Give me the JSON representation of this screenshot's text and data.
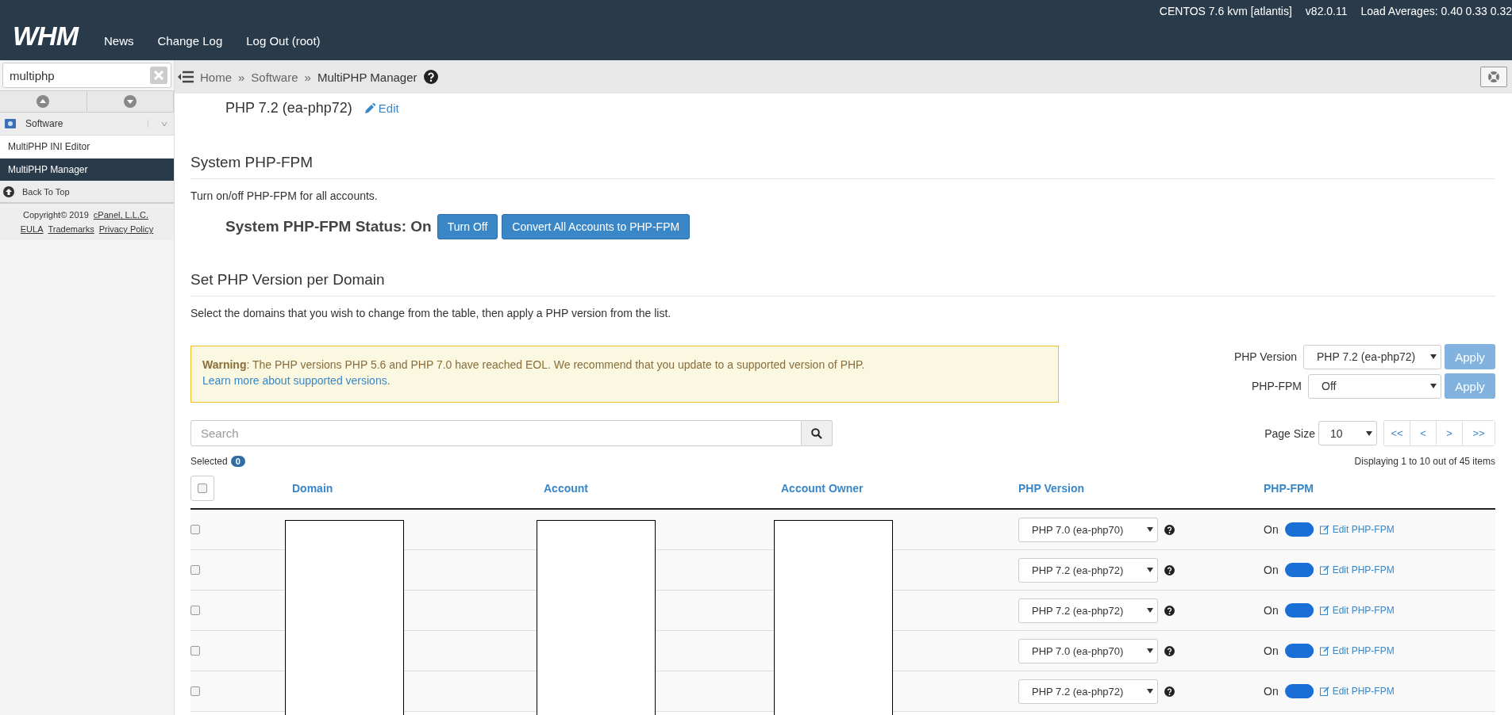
{
  "header": {
    "logo": "WHM",
    "nav": [
      "News",
      "Change Log",
      "Log Out (root)"
    ],
    "server_info": [
      "CENTOS 7.6 kvm [atlantis]",
      "v82.0.11",
      "Load Averages: 0.40 0.33 0.32"
    ]
  },
  "sidebar": {
    "search_value": "multiphp",
    "category": "Software",
    "items": [
      {
        "label": "MultiPHP INI Editor",
        "selected": false
      },
      {
        "label": "MultiPHP Manager",
        "selected": true
      }
    ],
    "back_to_top": "Back To Top",
    "copyright": "Copyright© 2019",
    "company": "cPanel, L.L.C.",
    "links": [
      "EULA",
      "Trademarks",
      "Privacy Policy"
    ]
  },
  "breadcrumb": [
    {
      "label": "Home",
      "separator": "»"
    },
    {
      "label": "Software",
      "separator": "»"
    },
    {
      "label": "MultiPHP Manager"
    }
  ],
  "system_default": {
    "version": "PHP 7.2 (ea-php72)",
    "edit": "Edit"
  },
  "fpm_section": {
    "title": "System PHP-FPM",
    "description": "Turn on/off PHP-FPM for all accounts.",
    "status": "System PHP-FPM Status: On",
    "buttons": [
      "Turn Off",
      "Convert All Accounts to PHP-FPM"
    ]
  },
  "domain_section": {
    "title": "Set PHP Version per Domain",
    "description": "Select the domains that you wish to change from the table, then apply a PHP version from the list.",
    "warning": {
      "text": "**Warning**: The PHP versions PHP 5.6 and PHP 7.0 have reached EOL. We recommend that you update to a supported version of PHP.",
      "link": "Learn more about supported versions",
      "after": "."
    },
    "controls": [
      {
        "label": "PHP Version",
        "value": "PHP 7.2 (ea-php72)",
        "button": "Apply"
      },
      {
        "label": "PHP-FPM",
        "value": "Off",
        "button": "Apply"
      }
    ],
    "search": {
      "placeholder": "Search"
    },
    "selected": {
      "label": "Selected",
      "count": "0"
    },
    "page_size": {
      "label": "Page Size",
      "value": "10"
    },
    "pager": [
      "<<",
      "<",
      ">",
      ">>"
    ],
    "displaying": "Displaying 1 to 10 out of 45 items"
  },
  "table": {
    "select_all": false,
    "columns": [
      "Domain",
      "Account",
      "Account Owner",
      "PHP Version",
      "PHP-FPM"
    ],
    "rows": [
      {
        "checked": false,
        "php_version": "PHP 7.0 (ea-php70)",
        "fpm_on": true,
        "fpm_label": "On",
        "edit": "Edit PHP-FPM"
      },
      {
        "checked": false,
        "php_version": "PHP 7.2 (ea-php72)",
        "fpm_on": true,
        "fpm_label": "On",
        "edit": "Edit PHP-FPM"
      },
      {
        "checked": false,
        "php_version": "PHP 7.2 (ea-php72)",
        "fpm_on": true,
        "fpm_label": "On",
        "edit": "Edit PHP-FPM"
      },
      {
        "checked": false,
        "php_version": "PHP 7.0 (ea-php70)",
        "fpm_on": true,
        "fpm_label": "On",
        "edit": "Edit PHP-FPM"
      },
      {
        "checked": false,
        "php_version": "PHP 7.2 (ea-php72)",
        "fpm_on": true,
        "fpm_label": "On",
        "edit": "Edit PHP-FPM"
      }
    ]
  }
}
